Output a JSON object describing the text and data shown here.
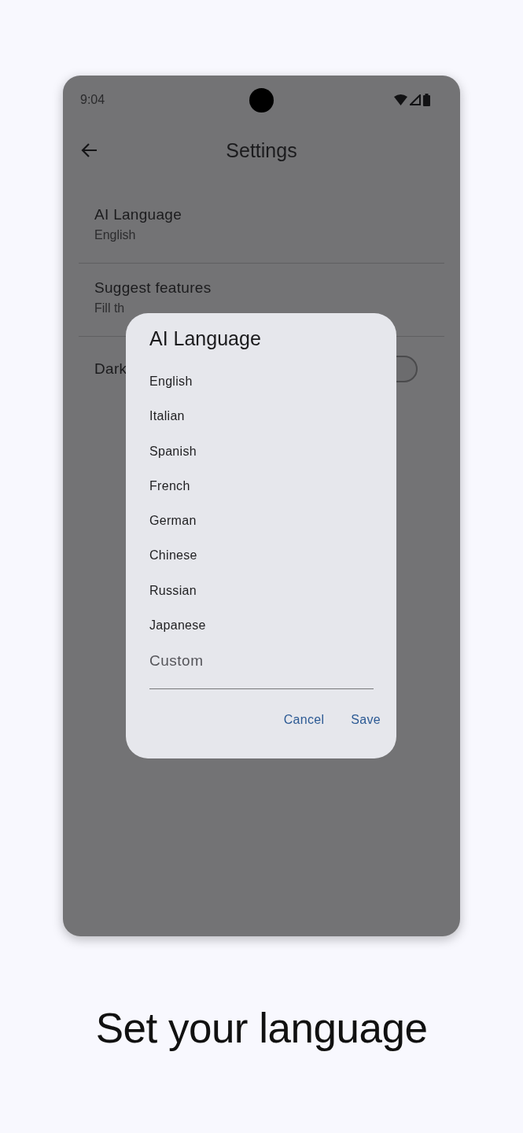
{
  "status_bar": {
    "time": "9:04"
  },
  "app_bar": {
    "title": "Settings"
  },
  "settings": [
    {
      "title": "AI Language",
      "subtitle": "English"
    },
    {
      "title": "Suggest features",
      "subtitle": "Fill th"
    },
    {
      "title": "Dark",
      "on": false
    }
  ],
  "dialog": {
    "title": "AI Language",
    "options": [
      "English",
      "Italian",
      "Spanish",
      "French",
      "German",
      "Chinese",
      "Russian",
      "Japanese"
    ],
    "custom_field": {
      "placeholder": "Custom"
    },
    "buttons": [
      "Cancel",
      "Save"
    ]
  },
  "caption": "Set your language"
}
